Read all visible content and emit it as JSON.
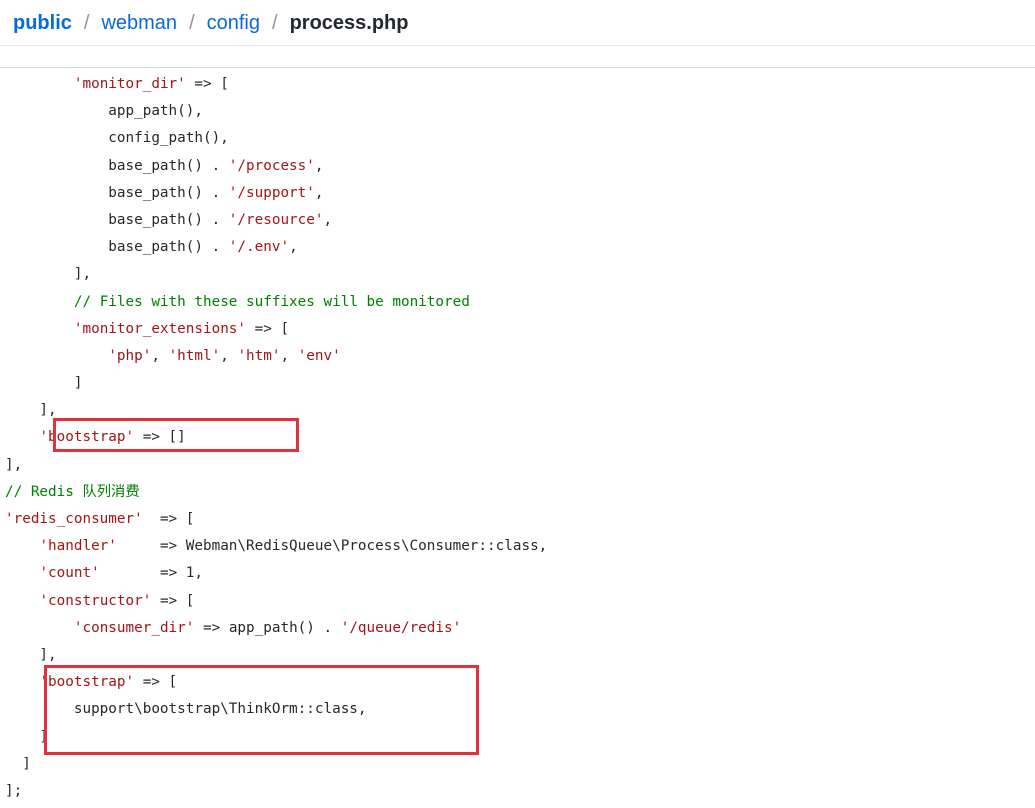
{
  "breadcrumb": {
    "root": "public",
    "items": [
      "webman",
      "config"
    ],
    "current": "process.php",
    "separator": "/"
  },
  "code_lines": [
    [
      {
        "t": "        ",
        "c": ""
      },
      {
        "t": "'monitor_dir'",
        "c": "str"
      },
      {
        "t": " => [",
        "c": ""
      }
    ],
    [
      {
        "t": "            app_path(),",
        "c": ""
      }
    ],
    [
      {
        "t": "            config_path(),",
        "c": ""
      }
    ],
    [
      {
        "t": "            base_path() . ",
        "c": ""
      },
      {
        "t": "'/process'",
        "c": "str"
      },
      {
        "t": ",",
        "c": ""
      }
    ],
    [
      {
        "t": "            base_path() . ",
        "c": ""
      },
      {
        "t": "'/support'",
        "c": "str"
      },
      {
        "t": ",",
        "c": ""
      }
    ],
    [
      {
        "t": "            base_path() . ",
        "c": ""
      },
      {
        "t": "'/resource'",
        "c": "str"
      },
      {
        "t": ",",
        "c": ""
      }
    ],
    [
      {
        "t": "            base_path() . ",
        "c": ""
      },
      {
        "t": "'/.env'",
        "c": "str"
      },
      {
        "t": ",",
        "c": ""
      }
    ],
    [
      {
        "t": "        ],",
        "c": ""
      }
    ],
    [
      {
        "t": "        ",
        "c": ""
      },
      {
        "t": "// Files with these suffixes will be monitored",
        "c": "cmt"
      }
    ],
    [
      {
        "t": "        ",
        "c": ""
      },
      {
        "t": "'monitor_extensions'",
        "c": "str"
      },
      {
        "t": " => [",
        "c": ""
      }
    ],
    [
      {
        "t": "            ",
        "c": ""
      },
      {
        "t": "'php'",
        "c": "str"
      },
      {
        "t": ", ",
        "c": ""
      },
      {
        "t": "'html'",
        "c": "str"
      },
      {
        "t": ", ",
        "c": ""
      },
      {
        "t": "'htm'",
        "c": "str"
      },
      {
        "t": ", ",
        "c": ""
      },
      {
        "t": "'env'",
        "c": "str"
      }
    ],
    [
      {
        "t": "        ]",
        "c": ""
      }
    ],
    [
      {
        "t": "    ],",
        "c": ""
      }
    ],
    [
      {
        "t": "    ",
        "c": ""
      },
      {
        "t": "'bootstrap'",
        "c": "str"
      },
      {
        "t": " => []",
        "c": ""
      }
    ],
    [
      {
        "t": "],",
        "c": ""
      }
    ],
    [
      {
        "t": "// Redis 队列消费",
        "c": "cmt"
      }
    ],
    [
      {
        "t": "'redis_consumer'",
        "c": "str"
      },
      {
        "t": "  => [",
        "c": ""
      }
    ],
    [
      {
        "t": "    ",
        "c": ""
      },
      {
        "t": "'handler'",
        "c": "str"
      },
      {
        "t": "     => Webman\\RedisQueue\\Process\\Consumer::class,",
        "c": ""
      }
    ],
    [
      {
        "t": "    ",
        "c": ""
      },
      {
        "t": "'count'",
        "c": "str"
      },
      {
        "t": "       => 1,",
        "c": ""
      }
    ],
    [
      {
        "t": "    ",
        "c": ""
      },
      {
        "t": "'constructor'",
        "c": "str"
      },
      {
        "t": " => [",
        "c": ""
      }
    ],
    [
      {
        "t": "        ",
        "c": ""
      },
      {
        "t": "'consumer_dir'",
        "c": "str"
      },
      {
        "t": " => app_path() . ",
        "c": ""
      },
      {
        "t": "'/queue/redis'",
        "c": "str"
      }
    ],
    [
      {
        "t": "    ],",
        "c": ""
      }
    ],
    [
      {
        "t": "    ",
        "c": ""
      },
      {
        "t": "'bootstrap'",
        "c": "str"
      },
      {
        "t": " => [",
        "c": ""
      }
    ],
    [
      {
        "t": "        support\\bootstrap\\ThinkOrm::class,",
        "c": ""
      }
    ],
    [
      {
        "t": "    ]",
        "c": ""
      }
    ],
    [
      {
        "t": "  ]",
        "c": ""
      }
    ],
    [
      {
        "t": "];",
        "c": ""
      }
    ]
  ],
  "colors": {
    "link": "#0969da",
    "string": "#a31515",
    "comment": "#008000",
    "highlight_border": "#e0323a"
  }
}
